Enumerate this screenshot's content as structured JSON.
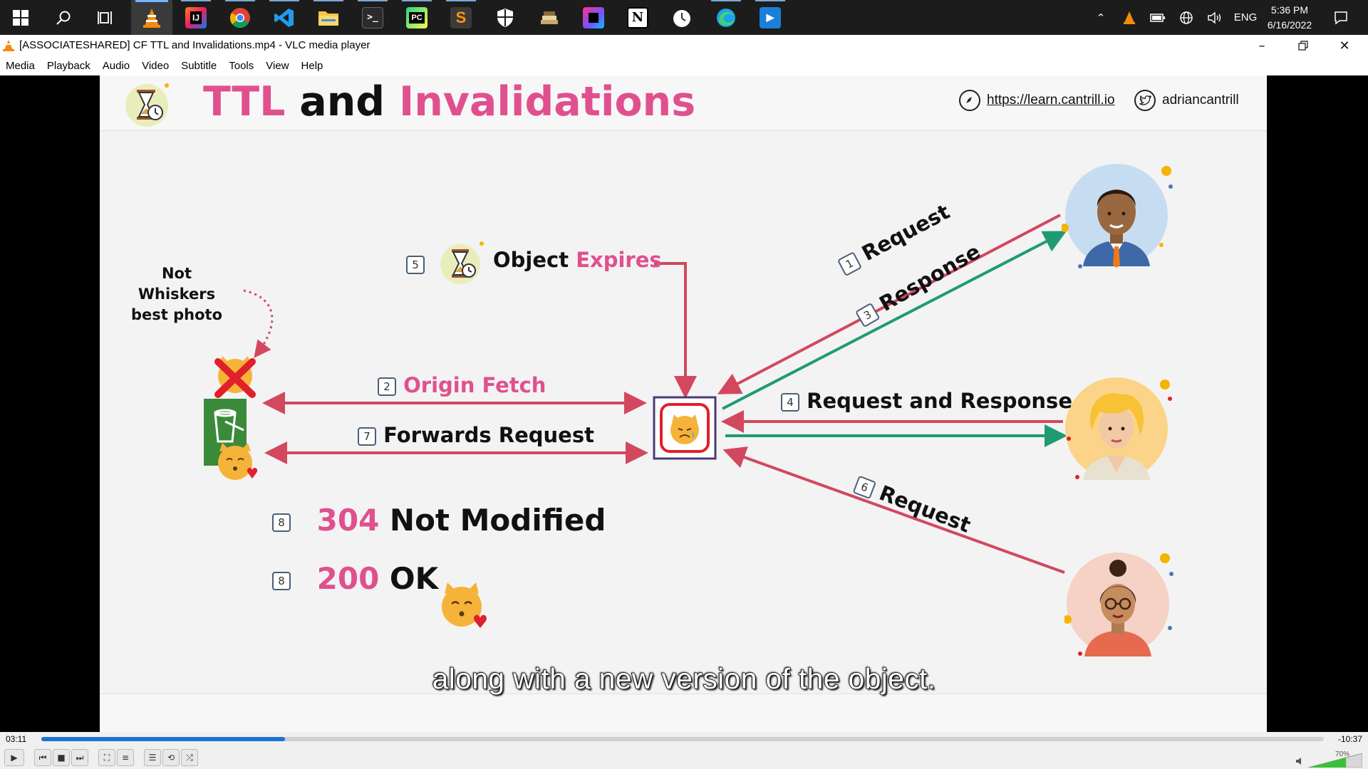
{
  "taskbar": {
    "apps": [
      "start",
      "search",
      "task-view",
      "vlc",
      "intellij",
      "chrome",
      "vscode",
      "file-explorer",
      "terminal",
      "pycharm",
      "sublime-text",
      "security",
      "stack-app",
      "jetbrains-toolbox",
      "notion",
      "clock-app",
      "edge",
      "media-app"
    ],
    "tray_language": "ENG",
    "time": "5:36 PM",
    "date": "6/16/2022"
  },
  "window": {
    "title": "[ASSOCIATESHARED] CF TTL and Invalidations.mp4 - VLC media player"
  },
  "menu": [
    "Media",
    "Playback",
    "Audio",
    "Video",
    "Subtitle",
    "Tools",
    "View",
    "Help"
  ],
  "slide": {
    "title_part1": "TTL",
    "title_part2": "and",
    "title_part3": "Invalidations",
    "link_url": "https://learn.cantrill.io",
    "link_handle": "adriancantrill",
    "note_line1": "Not Whiskers",
    "note_line2": "best photo",
    "step5_num": "5",
    "step5_word1": "Object",
    "step5_word2": "Expires",
    "step2_num": "2",
    "step2_label": "Origin Fetch",
    "step7_num": "7",
    "step7_label": "Forwards Request",
    "step1_num": "1",
    "step1_label": "Request",
    "step3_num": "3",
    "step3_label": "Response",
    "step4_num": "4",
    "step4_label": "Request and Response",
    "step6_num": "6",
    "step6_label": "Request",
    "result1_num": "8",
    "result1_code": "304",
    "result1_text": "Not Modified",
    "result2_num": "8",
    "result2_code": "200",
    "result2_text": "OK"
  },
  "subtitle": "along with a new version of the object.",
  "player": {
    "elapsed": "03:11",
    "remaining": "-10:37",
    "progress_fraction": 0.19,
    "volume": "70%",
    "volume_fraction": 0.7
  },
  "colors": {
    "pink": "#e0508f",
    "arrow_red": "#d2485f",
    "arrow_green": "#1f9b73",
    "seek_blue": "#1d73d0"
  }
}
